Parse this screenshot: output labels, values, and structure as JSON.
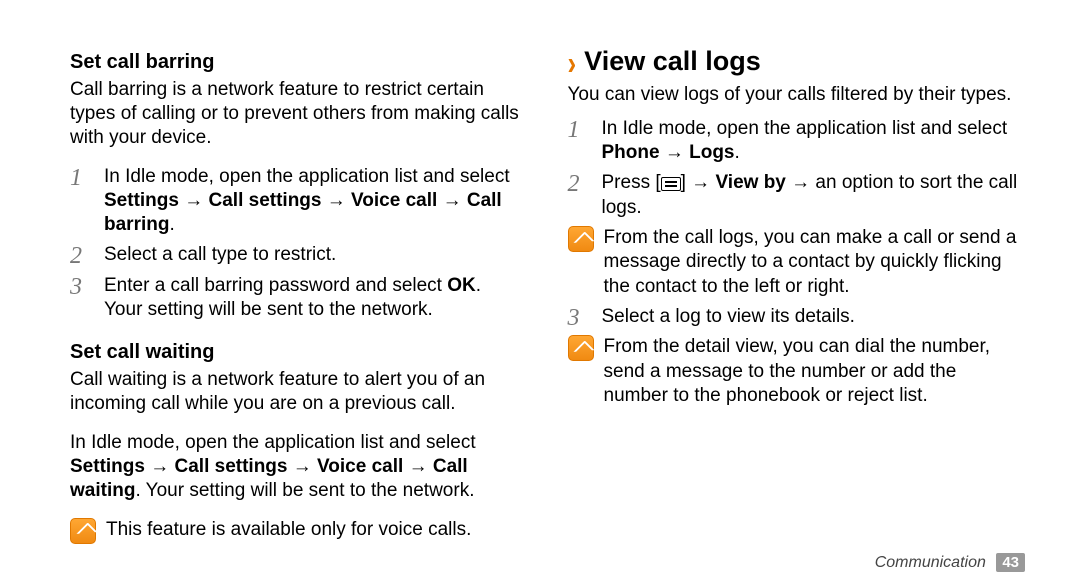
{
  "left": {
    "barring": {
      "heading": "Set call barring",
      "intro": "Call barring is a network feature to restrict certain types of calling or to prevent others from making calls with your device.",
      "step1_a": "In Idle mode, open the application list and select ",
      "step1_b": "Settings → Call settings → Voice call → Call barring",
      "step1_c": ".",
      "step2": "Select a call type to restrict.",
      "step3_a": "Enter a call barring password and select ",
      "step3_b": "OK",
      "step3_c": ".",
      "step3_d": "Your setting will be sent to the network."
    },
    "waiting": {
      "heading": "Set call waiting",
      "intro": "Call waiting is a network feature to alert you of an incoming call while you are on a previous call.",
      "body_a": "In Idle mode, open the application list and select ",
      "body_b": "Settings → Call settings → Voice call → Call waiting",
      "body_c": ". Your setting will be sent to the network.",
      "note": "This feature is available only for voice calls."
    }
  },
  "right": {
    "heading": "View call logs",
    "intro": "You can view logs of your calls filtered by their types.",
    "step1_a": "In Idle mode, open the application list and select ",
    "step1_b": "Phone → Logs",
    "step1_c": ".",
    "step2_a": "Press [",
    "step2_b": "] → ",
    "step2_c": "View by",
    "step2_d": " → an option to sort the call logs.",
    "note1": "From the call logs, you can make a call or send a message directly to a contact by quickly flicking the contact to the left or right.",
    "step3": "Select a log to view its details.",
    "note2": "From the detail view, you can dial the number, send a message to the number or add the number to the phonebook or reject list."
  },
  "footer": {
    "section": "Communication",
    "page": "43"
  }
}
